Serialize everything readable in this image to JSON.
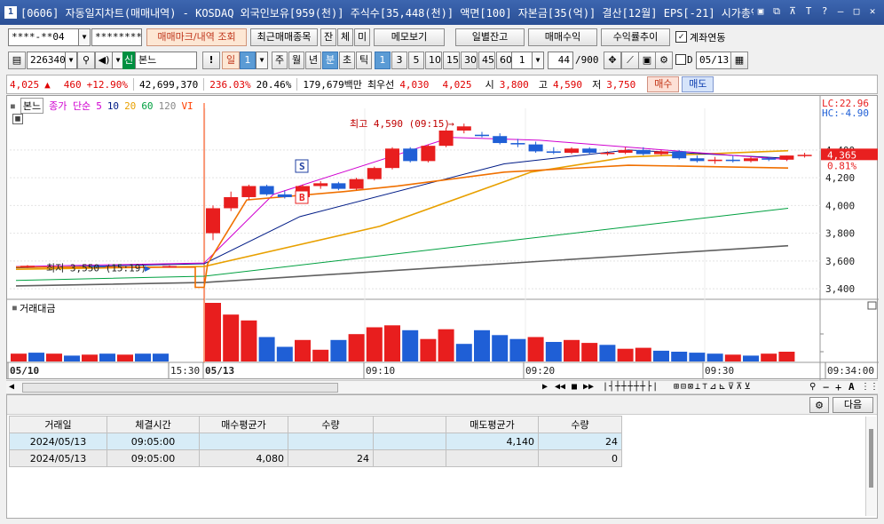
{
  "window": {
    "badge": "1",
    "title": "[0606] 자동일지차트(매매내역) - KOSDAQ 외국인보유[959(천)] 주식수[35,448(천)] 액면[100] 자본금[35(억)] 결산[12월] EPS[-21] 시가총액[1,4"
  },
  "toolbar1": {
    "account": "****-**04",
    "password": "********",
    "trade_lookup": "매매마크/내역 조회",
    "recent_trades": "최근매매종목",
    "jan": "잔",
    "che": "체",
    "mi": "미",
    "memo": "메모보기",
    "daily_balance": "일별잔고",
    "trade_profit": "매매수익",
    "return_trend": "수익률추이",
    "account_link": "계좌연동",
    "account_link_checked": true
  },
  "toolbar2": {
    "code": "226340",
    "badge_new": "신",
    "stock_name": "본느",
    "period_day": "일",
    "period_day_num": "1",
    "week": "주",
    "month": "월",
    "year": "년",
    "minute": "분",
    "second": "초",
    "tick": "틱",
    "minute_options": [
      "1",
      "3",
      "5",
      "10",
      "15",
      "30",
      "45",
      "60"
    ],
    "selected_minute": "1",
    "custom_value": "1",
    "count": "44",
    "count_max": "/900",
    "d_label": "D",
    "date": "05/13"
  },
  "pricebar": {
    "price": "4,025",
    "arrow": "▲",
    "change": "460",
    "change_pct": "+12.90%",
    "volume": "42,699,370",
    "vol_ratio": "236.03%",
    "turnover": "20.46%",
    "amount": "179,679백만",
    "best_label": "최우선",
    "best_ask": "4,030",
    "best_bid": "4,025",
    "open_label": "시",
    "open": "3,800",
    "high_label": "고",
    "high": "4,590",
    "low_label": "저",
    "low": "3,750",
    "buy": "매수",
    "sell": "매도"
  },
  "chart": {
    "legend": {
      "series": "본느",
      "ma_label": "종가 단순",
      "ma": [
        "5",
        "10",
        "20",
        "60",
        "120"
      ],
      "vi": "VI"
    },
    "high_marker": "최고 4,590 (09:15)",
    "low_marker": "최저 3,550 (15:19)",
    "lc": "LC:22.96",
    "hc": "HC:-4.90",
    "cur_price_tag": "4,365",
    "pct_tag": "0.81%",
    "y_ticks": [
      "4,400",
      "4,200",
      "4,000",
      "3,800",
      "3,600",
      "3,400"
    ],
    "sell_mark": "S",
    "buy_mark": "B",
    "volume_label": "거래대금",
    "x_labels": [
      "05/10",
      "15:30",
      "05/13",
      "09:10",
      "09:20",
      "09:30",
      "09:34:00"
    ]
  },
  "bottom": {
    "next": "다음"
  },
  "table": {
    "headers": [
      "거래일",
      "체결시간",
      "매수평균가",
      "수량",
      "",
      "매도평균가",
      "수량"
    ],
    "rows": [
      [
        "2024/05/13",
        "09:05:00",
        "",
        "",
        "",
        "4,140",
        "24"
      ],
      [
        "2024/05/13",
        "09:05:00",
        "4,080",
        "24",
        "",
        "",
        "0"
      ]
    ]
  },
  "chart_data": {
    "type": "candlestick",
    "y_range": [
      3330,
      4700
    ],
    "candles": [
      {
        "o": 3560,
        "h": 3570,
        "l": 3550,
        "c": 3565
      },
      {
        "o": 3565,
        "h": 3575,
        "l": 3558,
        "c": 3560
      },
      {
        "o": 3560,
        "h": 3568,
        "l": 3552,
        "c": 3563
      },
      {
        "o": 3800,
        "h": 4000,
        "l": 3750,
        "c": 3980
      },
      {
        "o": 3980,
        "h": 4100,
        "l": 3960,
        "c": 4060
      },
      {
        "o": 4060,
        "h": 4150,
        "l": 4040,
        "c": 4140
      },
      {
        "o": 4140,
        "h": 4150,
        "l": 4070,
        "c": 4080
      },
      {
        "o": 4080,
        "h": 4110,
        "l": 4050,
        "c": 4060
      },
      {
        "o": 4060,
        "h": 4150,
        "l": 4050,
        "c": 4140
      },
      {
        "o": 4140,
        "h": 4175,
        "l": 4120,
        "c": 4160
      },
      {
        "o": 4160,
        "h": 4170,
        "l": 4110,
        "c": 4120
      },
      {
        "o": 4120,
        "h": 4200,
        "l": 4110,
        "c": 4190
      },
      {
        "o": 4190,
        "h": 4280,
        "l": 4180,
        "c": 4270
      },
      {
        "o": 4270,
        "h": 4420,
        "l": 4260,
        "c": 4410
      },
      {
        "o": 4410,
        "h": 4420,
        "l": 4310,
        "c": 4320
      },
      {
        "o": 4320,
        "h": 4440,
        "l": 4310,
        "c": 4430
      },
      {
        "o": 4430,
        "h": 4560,
        "l": 4420,
        "c": 4540
      },
      {
        "o": 4540,
        "h": 4590,
        "l": 4520,
        "c": 4570
      },
      {
        "o": 4510,
        "h": 4530,
        "l": 4490,
        "c": 4500
      },
      {
        "o": 4500,
        "h": 4520,
        "l": 4440,
        "c": 4450
      },
      {
        "o": 4450,
        "h": 4480,
        "l": 4420,
        "c": 4440
      },
      {
        "o": 4440,
        "h": 4460,
        "l": 4380,
        "c": 4390
      },
      {
        "o": 4390,
        "h": 4420,
        "l": 4370,
        "c": 4380
      },
      {
        "o": 4380,
        "h": 4420,
        "l": 4370,
        "c": 4410
      },
      {
        "o": 4410,
        "h": 4420,
        "l": 4370,
        "c": 4380
      },
      {
        "o": 4380,
        "h": 4390,
        "l": 4360,
        "c": 4380
      },
      {
        "o": 4380,
        "h": 4420,
        "l": 4370,
        "c": 4400
      },
      {
        "o": 4400,
        "h": 4420,
        "l": 4360,
        "c": 4370
      },
      {
        "o": 4370,
        "h": 4400,
        "l": 4360,
        "c": 4390
      },
      {
        "o": 4390,
        "h": 4400,
        "l": 4330,
        "c": 4340
      },
      {
        "o": 4340,
        "h": 4360,
        "l": 4310,
        "c": 4320
      },
      {
        "o": 4320,
        "h": 4350,
        "l": 4300,
        "c": 4330
      },
      {
        "o": 4330,
        "h": 4360,
        "l": 4310,
        "c": 4320
      },
      {
        "o": 4320,
        "h": 4350,
        "l": 4310,
        "c": 4340
      },
      {
        "o": 4340,
        "h": 4350,
        "l": 4320,
        "c": 4330
      },
      {
        "o": 4330,
        "h": 4360,
        "l": 4320,
        "c": 4360
      },
      {
        "o": 4360,
        "h": 4380,
        "l": 4345,
        "c": 4365
      }
    ],
    "volume": [
      8,
      9,
      8,
      6,
      7,
      8,
      7,
      8,
      8,
      60,
      48,
      42,
      25,
      15,
      22,
      12,
      22,
      28,
      35,
      37,
      32,
      23,
      33,
      18,
      32,
      27,
      23,
      25,
      20,
      22,
      19,
      17,
      13,
      14,
      11,
      10,
      9,
      8,
      7,
      6,
      8,
      10
    ],
    "volume_colors": [
      "r",
      "b",
      "r",
      "b",
      "r",
      "b",
      "r",
      "b",
      "b",
      "r",
      "r",
      "r",
      "b",
      "b",
      "r",
      "r",
      "b",
      "r",
      "r",
      "r",
      "b",
      "r",
      "r",
      "b",
      "b",
      "b",
      "b",
      "r",
      "b",
      "r",
      "r",
      "b",
      "r",
      "r",
      "b",
      "b",
      "b",
      "b",
      "r",
      "b",
      "r",
      "r"
    ]
  },
  "colors": {
    "up": "#e81e1e",
    "down": "#1f5fd6",
    "ma5": "#d000d0",
    "ma10": "#001b86",
    "ma20": "#e8a000",
    "ma60": "#00a040",
    "ma120": "#606060",
    "vi_line": "#ff4000",
    "orange_line": "#f07000"
  }
}
